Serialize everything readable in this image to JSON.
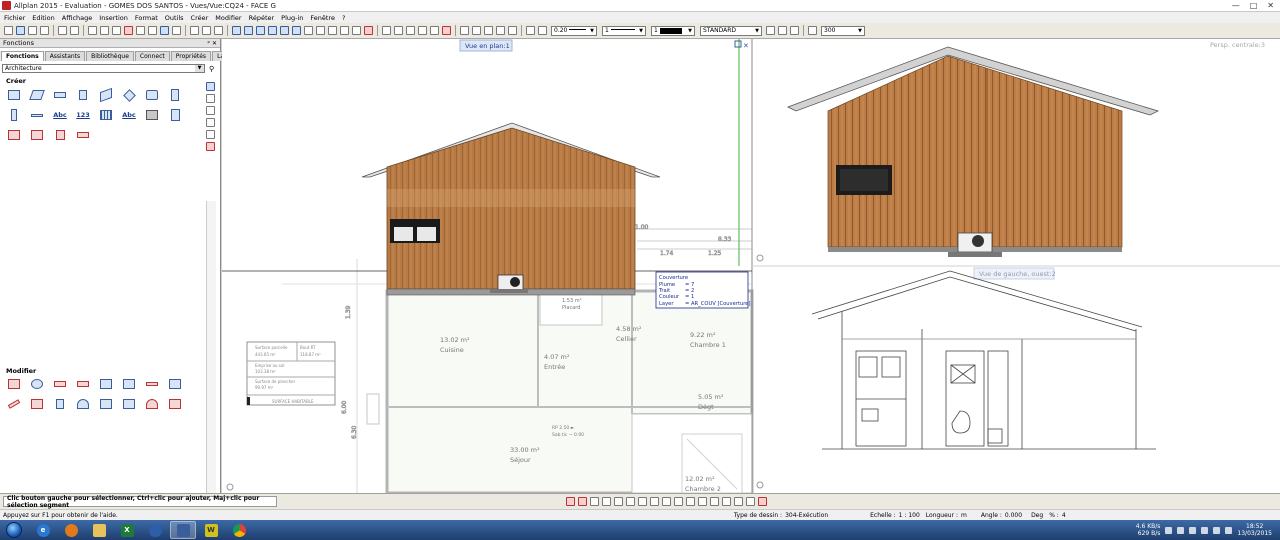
{
  "window": {
    "title": "Allplan 2015 - Evaluation - GOMES DOS SANTOS - Vues/Vue:CQ24 - FACE G",
    "controls": [
      "—",
      "□",
      "✕"
    ]
  },
  "menu": [
    "Fichier",
    "Edition",
    "Affichage",
    "Insertion",
    "Format",
    "Outils",
    "Créer",
    "Modifier",
    "Répéter",
    "Plug-in",
    "Fenêtre",
    "?"
  ],
  "toolbar": {
    "pen": "0.20",
    "line": "1",
    "color": "1",
    "layer": "STANDARD",
    "scale_ref": "300"
  },
  "panel": {
    "title": "Fonctions",
    "tabs": [
      "Fonctions",
      "Assistants",
      "Bibliothèque",
      "Connect",
      "Propriétés",
      "Layer"
    ],
    "active_tab": "Fonctions",
    "module": "Architecture",
    "create_label": "Créer",
    "modify_label": "Modifier",
    "create_texts": [
      "Abc",
      "123",
      "Abc"
    ]
  },
  "viewports": {
    "plan_label": "Vue en plan:1",
    "persp_label": "Persp. centrale:3",
    "left_label": "Vue de gauche, ouest:2"
  },
  "plan": {
    "dims": [
      "1.74",
      "8.33",
      "1.25",
      "1.00",
      "1.39",
      "6.00",
      "6.30"
    ],
    "rooms": [
      {
        "name": "Cuisine",
        "area": "13.02 m²"
      },
      {
        "name": "Entrée",
        "area": "4.07 m²"
      },
      {
        "name": "Cellier",
        "area": "4.58 m²"
      },
      {
        "name": "Chambre 1",
        "area": "9.22 m²"
      },
      {
        "name": "Dégt",
        "area": "5.05 m²"
      },
      {
        "name": "Séjour",
        "area": "33.00 m²"
      },
      {
        "name": "Chambre 2",
        "area": "12.02 m²"
      },
      {
        "name": "Placard",
        "area": "1.53 m²"
      }
    ],
    "stair_note": [
      "RP 2.50 ►",
      "Sab tic ~ 0.00"
    ],
    "legend": {
      "rows": [
        [
          "Surface parcelle",
          "Bout RT"
        ],
        [
          "443.65 m²",
          "118.87 m²"
        ],
        [
          "Emprise au sol",
          ""
        ],
        [
          "103.38 m²",
          ""
        ],
        [
          "Surface de plancher",
          ""
        ],
        [
          "90.97 m²",
          ""
        ]
      ],
      "footer": "SURFACE HABITABLE"
    }
  },
  "tooltip": {
    "title": "Couverture",
    "rows": [
      [
        "Plume",
        "= 7"
      ],
      [
        "Trait",
        "= 2"
      ],
      [
        "Couleur",
        "= 1"
      ],
      [
        "Layer",
        "= AR_COUV [Couverture]"
      ]
    ]
  },
  "status": {
    "message": "Clic bouton gauche pour sélectionner, Ctrl+clic pour ajouter, Maj+clic pour sélection segment",
    "hint": "Appuyez sur F1 pour obtenir de l'aide.",
    "drawing_type_label": "Type de dessin :",
    "drawing_type": "304-Exécution",
    "scale_label": "Echelle :",
    "scale": "1 : 100",
    "length_label": "Longueur :",
    "length_unit": "m",
    "angle_label": "Angle :",
    "angle": "0.000",
    "angle_unit": "Deg",
    "percent_label": "% :",
    "percent": "4"
  },
  "taskbar": {
    "net_up": "4.6 KB/s",
    "net_down": "629 B/s",
    "time": "18:52",
    "date": "13/03/2015",
    "apps": [
      "ie",
      "firefox",
      "explorer",
      "excel",
      "outlook",
      "allplan",
      "winamp",
      "chrome"
    ]
  },
  "colors": {
    "wood": "#b87a45",
    "roof": "#cfcfcf",
    "accent": "#4a7bd0"
  }
}
